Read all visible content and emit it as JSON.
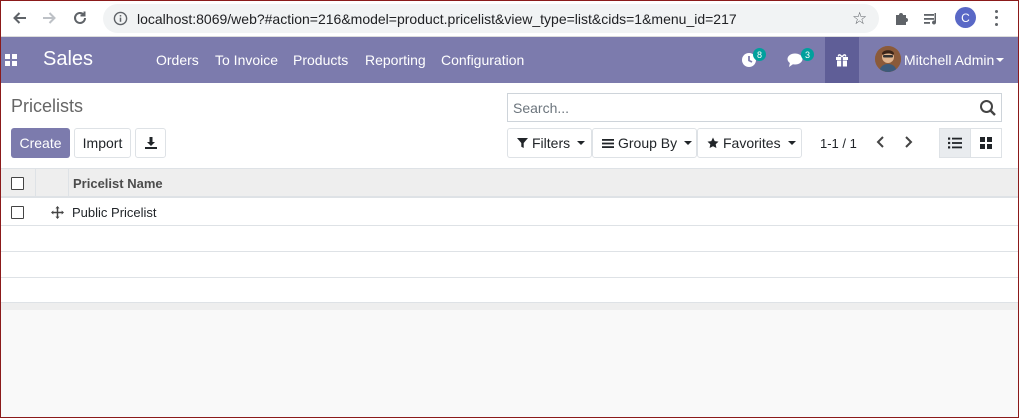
{
  "browser": {
    "url": "localhost:8069/web?#action=216&model=product.pricelist&view_type=list&cids=1&menu_id=217",
    "profile_initial": "C",
    "icons": [
      "back-arrow-icon",
      "forward-arrow-icon",
      "reload-icon",
      "info-icon",
      "star-icon",
      "puzzle-icon",
      "media-icon",
      "kebab-menu-icon"
    ]
  },
  "navbar": {
    "app_name": "Sales",
    "menu": [
      "Orders",
      "To Invoice",
      "Products",
      "Reporting",
      "Configuration"
    ],
    "activity_count": "8",
    "message_count": "3",
    "user_name": "Mitchell Admin",
    "accent_color": "#7c7bad"
  },
  "control_panel": {
    "breadcrumb": "Pricelists",
    "create_label": "Create",
    "import_label": "Import",
    "search_placeholder": "Search...",
    "filters_label": "Filters",
    "group_by_label": "Group By",
    "favorites_label": "Favorites",
    "pager": "1-1 / 1"
  },
  "table": {
    "columns": [
      "Pricelist Name"
    ],
    "rows": [
      {
        "name": "Public Pricelist"
      }
    ]
  }
}
